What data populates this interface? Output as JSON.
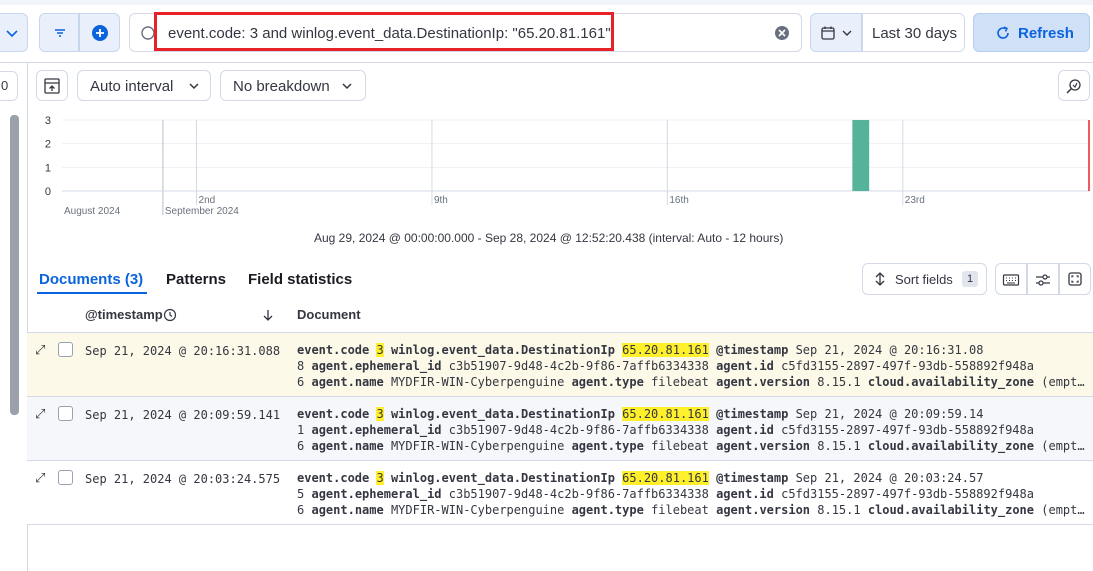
{
  "query_bar": {
    "query": "event.code: 3 and winlog.event_data.DestinationIp: \"65.20.81.161\"",
    "time_range": "Last 30 days",
    "refresh_label": "Refresh"
  },
  "left_rail": {
    "badge": "0"
  },
  "chart_toolbar": {
    "interval_label": "Auto interval",
    "breakdown_label": "No breakdown"
  },
  "chart_data": {
    "type": "bar",
    "x_ticks": [
      "2nd",
      "9th",
      "16th",
      "23rd"
    ],
    "x_secondary": [
      "August 2024",
      "September 2024"
    ],
    "y_ticks": [
      "0",
      "1",
      "2",
      "3"
    ],
    "ylim": [
      0,
      3
    ],
    "bars": [
      {
        "x": "Sep 21, 2024",
        "value": 3
      }
    ],
    "bar_color": "#54b399",
    "caption": "Aug 29, 2024 @ 00:00:00.000 - Sep 28, 2024 @ 12:52:20.438 (interval: Auto - 12 hours)"
  },
  "tabs": {
    "documents": "Documents (3)",
    "patterns": "Patterns",
    "field_statistics": "Field statistics"
  },
  "sort_fields": {
    "label": "Sort fields",
    "count": "1"
  },
  "table": {
    "col_timestamp": "@timestamp",
    "col_document": "Document",
    "rows": [
      {
        "timestamp": "Sep 21, 2024 @ 20:16:31.088",
        "code": "3",
        "dest_ip": "65.20.81.161",
        "ts_value": "Sep 21, 2024 @ 20:16:31.08",
        "l2_prefix": "8",
        "ephemeral_id": "c3b51907-9d48-4c2b-9f86-7affb6334338",
        "agent_id": "c5fd3155-2897-497f-93db-558892f948a",
        "l3_prefix": "6",
        "agent_name": "MYDFIR-WIN-Cyberpenguine",
        "agent_type": "filebeat",
        "agent_version": "8.15.1",
        "az_value": "(empt…"
      },
      {
        "timestamp": "Sep 21, 2024 @ 20:09:59.141",
        "code": "3",
        "dest_ip": "65.20.81.161",
        "ts_value": "Sep 21, 2024 @ 20:09:59.14",
        "l2_prefix": "1",
        "ephemeral_id": "c3b51907-9d48-4c2b-9f86-7affb6334338",
        "agent_id": "c5fd3155-2897-497f-93db-558892f948a",
        "l3_prefix": "6",
        "agent_name": "MYDFIR-WIN-Cyberpenguine",
        "agent_type": "filebeat",
        "agent_version": "8.15.1",
        "az_value": "(empt…"
      },
      {
        "timestamp": "Sep 21, 2024 @ 20:03:24.575",
        "code": "3",
        "dest_ip": "65.20.81.161",
        "ts_value": "Sep 21, 2024 @ 20:03:24.57",
        "l2_prefix": "5",
        "ephemeral_id": "c3b51907-9d48-4c2b-9f86-7affb6334338",
        "agent_id": "c5fd3155-2897-497f-93db-558892f948a",
        "l3_prefix": "6",
        "agent_name": "MYDFIR-WIN-Cyberpenguine",
        "agent_type": "filebeat",
        "agent_version": "8.15.1",
        "az_value": "(empt…"
      }
    ]
  },
  "field_names": {
    "event_code": "event.code",
    "dest_ip": "winlog.event_data.DestinationIp",
    "timestamp": "@timestamp",
    "ephemeral_id": "agent.ephemeral_id",
    "agent_id": "agent.id",
    "agent_name": "agent.name",
    "agent_type": "agent.type",
    "agent_version": "agent.version",
    "cloud_az": "cloud.availability_zone"
  },
  "colors": {
    "accent": "#0b64dd",
    "highlight": "#fff02b",
    "annotation_red": "#e7222a",
    "bar": "#54b399"
  }
}
